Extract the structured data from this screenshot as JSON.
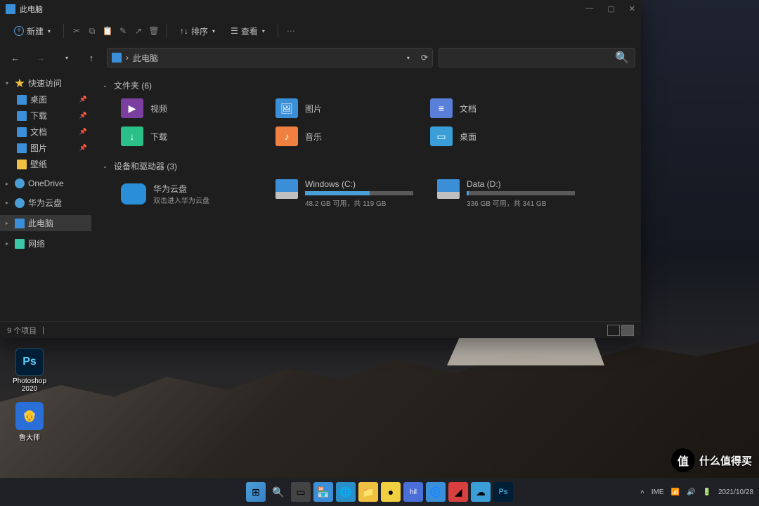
{
  "window": {
    "title": "此电脑",
    "toolbar": {
      "new": "新建",
      "sort": "排序",
      "view": "查看"
    },
    "address": {
      "path": "此电脑"
    },
    "status": "9 个项目"
  },
  "sidebar": {
    "quick_access": "快速访问",
    "items": [
      {
        "label": "桌面"
      },
      {
        "label": "下载"
      },
      {
        "label": "文档"
      },
      {
        "label": "图片"
      },
      {
        "label": "壁纸"
      }
    ],
    "onedrive": "OneDrive",
    "huawei": "华为云盘",
    "this_pc": "此电脑",
    "network": "网络"
  },
  "content": {
    "folders_header": "文件夹 (6)",
    "folders": [
      {
        "label": "视频"
      },
      {
        "label": "图片"
      },
      {
        "label": "文档"
      },
      {
        "label": "下载"
      },
      {
        "label": "音乐"
      },
      {
        "label": "桌面"
      }
    ],
    "devices_header": "设备和驱动器 (3)",
    "huawei_cloud": {
      "title": "华为云盘",
      "sub": "双击进入华为云盘"
    },
    "drives": [
      {
        "name": "Windows (C:)",
        "info": "48.2 GB 可用，共 119 GB",
        "used_pct": 60
      },
      {
        "name": "Data (D:)",
        "info": "336 GB 可用，共 341 GB",
        "used_pct": 2
      }
    ]
  },
  "desktop": {
    "ps": "Photoshop 2020",
    "ludashi": "鲁大师"
  },
  "tray": {
    "ime": "IME",
    "date": "2021/10/28"
  },
  "watermark": "什么值得买"
}
